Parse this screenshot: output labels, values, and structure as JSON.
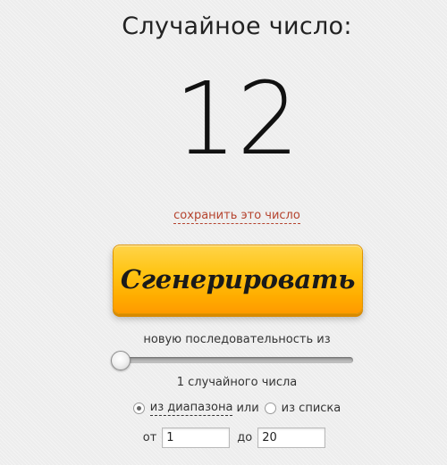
{
  "header": {
    "title": "Случайное число:"
  },
  "result": {
    "number": "12"
  },
  "save": {
    "label": "сохранить это число"
  },
  "generate": {
    "label": "Сгенерировать"
  },
  "sequence": {
    "label": "новую последовательность из",
    "slider_fraction": 0.0,
    "count_text": "1 случайного числа"
  },
  "mode": {
    "range_label": "из диапазона",
    "or_label": "или",
    "list_label": "из списка",
    "selected": "range"
  },
  "range": {
    "from_label": "от",
    "from_value": "1",
    "to_label": "до",
    "to_value": "20"
  },
  "colors": {
    "link": "#b5432e",
    "button_top": "#ffd44a",
    "button_bottom": "#ff9a00"
  },
  "icons": {
    "slider_knob": "slider-knob",
    "radio_selected": "radio-selected-icon",
    "radio_unselected": "radio-unselected-icon"
  }
}
